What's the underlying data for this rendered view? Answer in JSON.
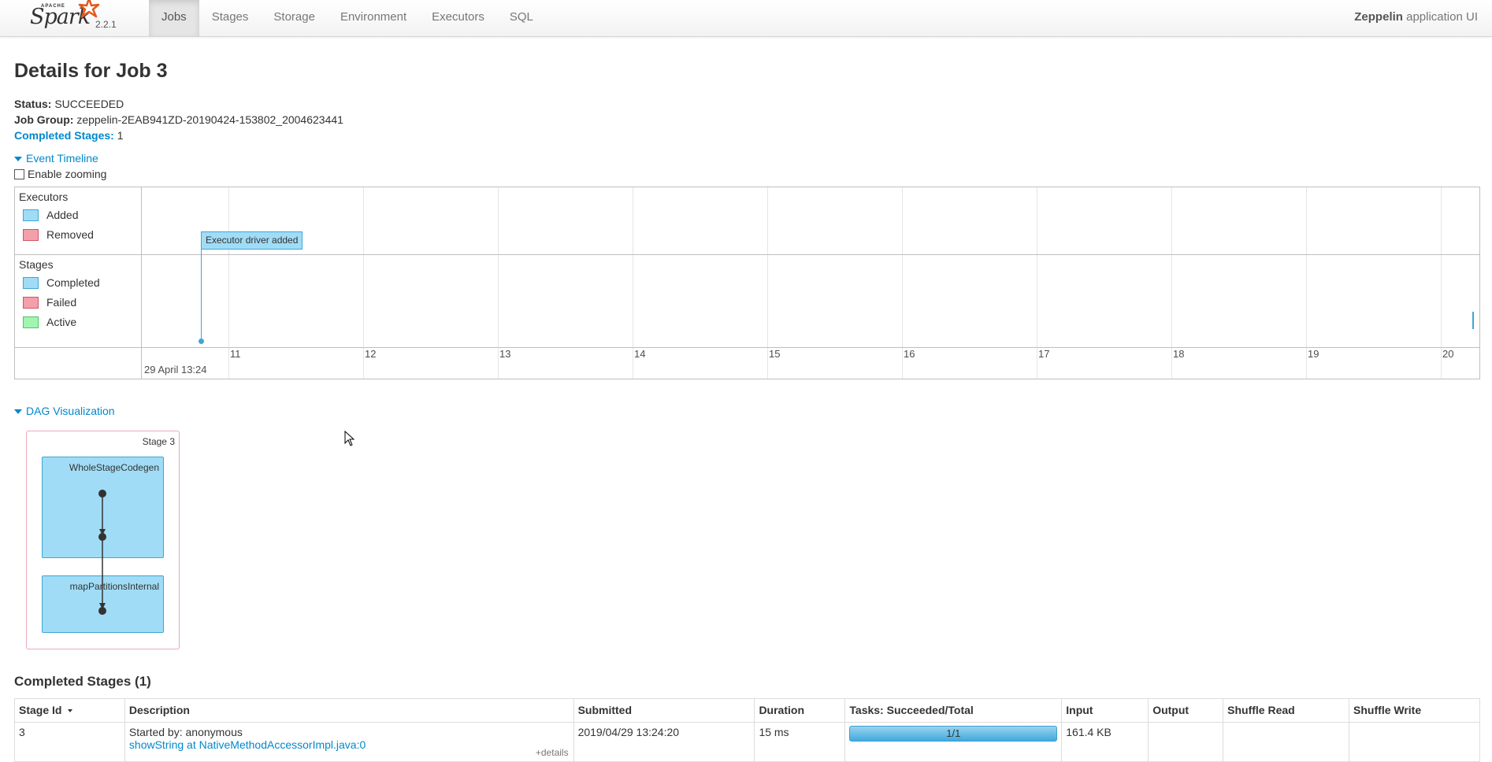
{
  "navbar": {
    "brand_word": "Spark",
    "brand_apache": "APACHE",
    "version": "2.2.1",
    "tabs": [
      {
        "label": "Jobs",
        "active": true
      },
      {
        "label": "Stages"
      },
      {
        "label": "Storage"
      },
      {
        "label": "Environment"
      },
      {
        "label": "Executors"
      },
      {
        "label": "SQL"
      }
    ],
    "app_name_bold": "Zeppelin",
    "app_name_suffix": " application UI"
  },
  "page": {
    "title": "Details for Job 3"
  },
  "summary": {
    "status_label": "Status:",
    "status_value": "SUCCEEDED",
    "job_group_label": "Job Group:",
    "job_group_value": "zeppelin-2EAB941ZD-20190424-153802_2004623441",
    "completed_stages_label": "Completed Stages:",
    "completed_stages_value": "1"
  },
  "timeline": {
    "expander_label": "Event Timeline",
    "zoom_label": "Enable zooming",
    "executors_heading": "Executors",
    "executor_legend": [
      "Added",
      "Removed"
    ],
    "stages_heading": "Stages",
    "stage_legend": [
      "Completed",
      "Failed",
      "Active"
    ],
    "ticks": [
      "11",
      "12",
      "13",
      "14",
      "15",
      "16",
      "17",
      "18",
      "19",
      "20"
    ],
    "major_label": "29 April 13:24",
    "event_label": "Executor driver added"
  },
  "dag": {
    "expander_label": "DAG Visualization",
    "stage_label": "Stage 3",
    "clusters": [
      "WholeStageCodegen",
      "mapPartitionsInternal"
    ]
  },
  "completed_stages": {
    "heading": "Completed Stages (1)",
    "columns": [
      "Stage Id",
      "Description",
      "Submitted",
      "Duration",
      "Tasks: Succeeded/Total",
      "Input",
      "Output",
      "Shuffle Read",
      "Shuffle Write"
    ],
    "rows": [
      {
        "stage_id": "3",
        "started_by": "Started by: anonymous",
        "description_link": "showString at NativeMethodAccessorImpl.java:0",
        "details": "+details",
        "submitted": "2019/04/29 13:24:20",
        "duration": "15 ms",
        "tasks": "1/1",
        "tasks_fraction": 1.0,
        "input": "161.4 KB",
        "output": "",
        "shuffle_read": "",
        "shuffle_write": ""
      }
    ]
  }
}
